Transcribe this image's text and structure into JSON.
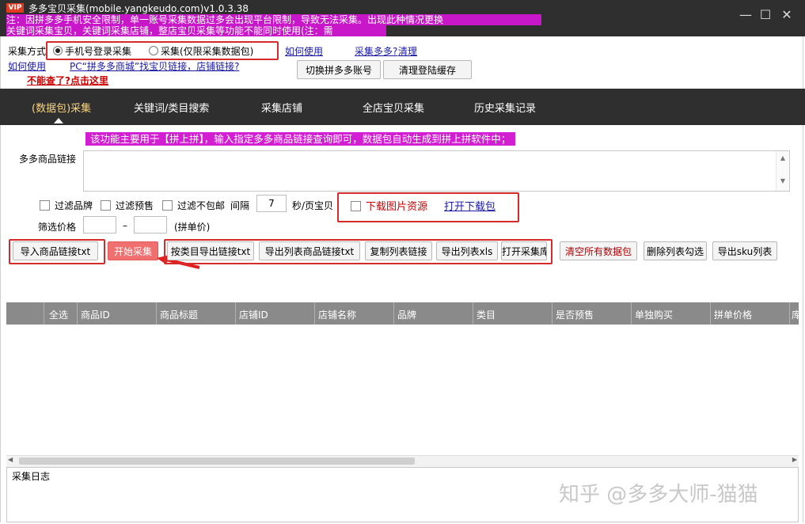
{
  "window": {
    "vip_badge": "VIP",
    "title": "多多宝贝采集(mobile.yangkeudo.com)v1.0.3.38",
    "notice_line1": "注：因拼多多手机安全限制，单一账号采集数据过多会出现平台限制，导致无法采集。出现此种情况更换",
    "notice_line2": "关键词采集宝贝，关键词采集店铺，整店宝贝采集等功能不能同时使用(注：需",
    "minimize_icon": "—",
    "maximize_icon": "☐",
    "close_icon": "✕"
  },
  "settings": {
    "mode_label": "采集方式",
    "mode_option1": "手机号登录采集",
    "mode_option2": "采集(仅限采集数据包)",
    "how_to_use_link": "如何使用",
    "how_to_use_link_tail": "采集多多?",
    "clear_link": "清理",
    "find_link_text": "如何使用",
    "find_link_tail": "PC“拼多多商城”找宝贝链接，店铺链接?",
    "warning_link": "不能查了?点击这里",
    "switch_account_button": "切换拼多多账号",
    "clear_cache_button": "清理登陆缓存"
  },
  "nav": {
    "tabs": [
      "(数据包)采集",
      "关键词/类目搜索",
      "采集店铺",
      "全店宝贝采集",
      "历史采集记录"
    ]
  },
  "form": {
    "hint": "该功能主要用于【拼上拼】，输入指定多多商品链接查询即可，数据包自动生成到拼上拼软件中；",
    "link_label": "多多商品链接",
    "filter_brand": "过滤品牌",
    "filter_presale": "过滤预售",
    "filter_no_free_ship": "过滤不包邮",
    "interval_label": "间隔",
    "interval_value": "7",
    "interval_unit": "秒/页宝贝",
    "download_images": "下载图片资源",
    "open_download": "打开下载包",
    "price_label": "筛选价格",
    "price_dash": "–",
    "price_unit": "(拼单价)"
  },
  "actions": {
    "import_links": "导入商品链接txt",
    "start": "开始采集",
    "export_by_category": "按类目导出链接txt",
    "export_list_links": "导出列表商品链接txt",
    "copy_list_links": "复制列表链接",
    "export_xls": "导出列表xls",
    "open_library": "打开采集库",
    "clear_all": "清空所有数据包",
    "delete_checked": "删除列表勾选",
    "export_sku": "导出sku列表"
  },
  "table": {
    "columns": [
      "全选",
      "商品ID",
      "商品标题",
      "店铺ID",
      "店铺名称",
      "品牌",
      "类目",
      "是否预售",
      "单独购买",
      "拼单价格",
      "库"
    ]
  },
  "log": {
    "label": "采集日志"
  },
  "watermark": "知乎 @多多大师-猫猫",
  "colors": {
    "titlebar": "#2f2f2f",
    "notice_magenta": "#c817c8",
    "annotation_red": "#d52b2b",
    "start_button": "#f07070",
    "table_header": "#8a8a8a"
  }
}
